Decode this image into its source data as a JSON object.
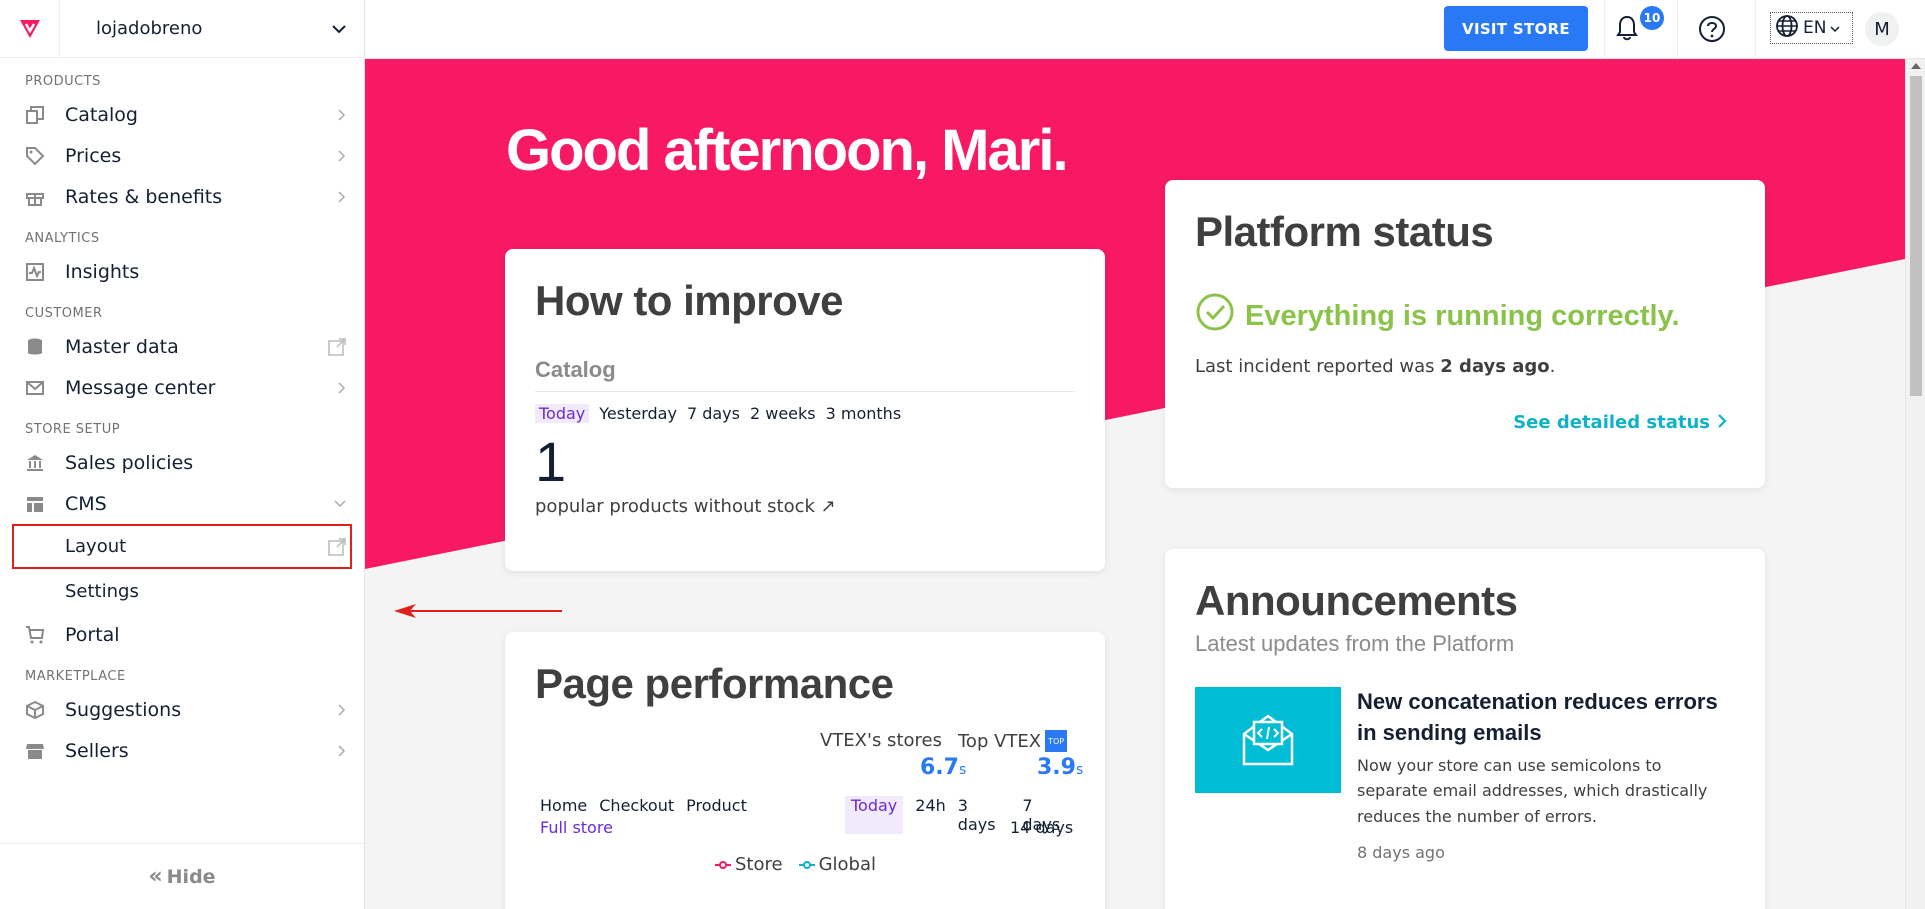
{
  "sidebar": {
    "store_name": "lojadobreno",
    "sections": [
      {
        "title": "PRODUCTS",
        "items": [
          {
            "label": "Catalog",
            "icon": "catalog-icon"
          },
          {
            "label": "Prices",
            "icon": "tag-icon"
          },
          {
            "label": "Rates & benefits",
            "icon": "gift-icon"
          }
        ]
      },
      {
        "title": "ANALYTICS",
        "items": [
          {
            "label": "Insights",
            "icon": "insights-icon"
          }
        ]
      },
      {
        "title": "CUSTOMER",
        "items": [
          {
            "label": "Master data",
            "icon": "database-icon"
          },
          {
            "label": "Message center",
            "icon": "mail-icon"
          }
        ]
      },
      {
        "title": "STORE SETUP",
        "items": [
          {
            "label": "Sales policies",
            "icon": "bank-icon"
          },
          {
            "label": "CMS",
            "icon": "layout-icon"
          },
          {
            "label": "Layout"
          },
          {
            "label": "Settings"
          },
          {
            "label": "Portal",
            "icon": "cart-icon"
          }
        ]
      },
      {
        "title": "MARKETPLACE",
        "items": [
          {
            "label": "Suggestions",
            "icon": "box-icon"
          },
          {
            "label": "Sellers",
            "icon": "store-icon"
          }
        ]
      }
    ],
    "hide_label": "Hide"
  },
  "topbar": {
    "visit_store": "VISIT STORE",
    "notifications_count": "10",
    "language": "EN",
    "avatar_initial": "M"
  },
  "main": {
    "greeting_prefix": "Good afternoon, ",
    "greeting_name": "Mari",
    "greeting_suffix": ".",
    "improve": {
      "title": "How to improve",
      "subtitle": "Catalog",
      "periods": [
        "Today",
        "Yesterday",
        "7 days",
        "2 weeks",
        "3 months"
      ],
      "value": "1",
      "caption": "popular products without stock ↗"
    },
    "status": {
      "title": "Platform status",
      "ok_message": "Everything is running correctly.",
      "incident_prefix": "Last incident reported was ",
      "incident_time": "2 days ago",
      "incident_suffix": ".",
      "detail_link": "See detailed status"
    },
    "performance": {
      "title": "Page performance",
      "vtex_label": "VTEX's stores",
      "vtex_value": "6.7",
      "top_label": "Top VTEX",
      "top_badge": "TOP",
      "top_value": "3.9",
      "unit": "s",
      "pages": [
        "Home",
        "Checkout",
        "Product"
      ],
      "full_store": "Full store",
      "ranges": [
        "Today",
        "24h",
        "3 days",
        "7 days"
      ],
      "range_extra": "14 days",
      "legend_store": "Store",
      "legend_global": "Global",
      "store_color": "#f71963",
      "global_color": "#0fb2c6"
    },
    "announcements": {
      "title": "Announcements",
      "subtitle": "Latest updates from the Platform",
      "item_title": "New concatenation reduces errors in sending emails",
      "item_desc": "Now your store can use semicolons to separate email addresses, which drastically reduces the number of errors.",
      "item_date": "8 days ago"
    }
  },
  "colors": {
    "brand_pink": "#f71963",
    "accent_blue": "#2978f5",
    "success_green": "#8bc34a",
    "link_teal": "#0fb2c6",
    "highlight_red": "#e0201c"
  }
}
